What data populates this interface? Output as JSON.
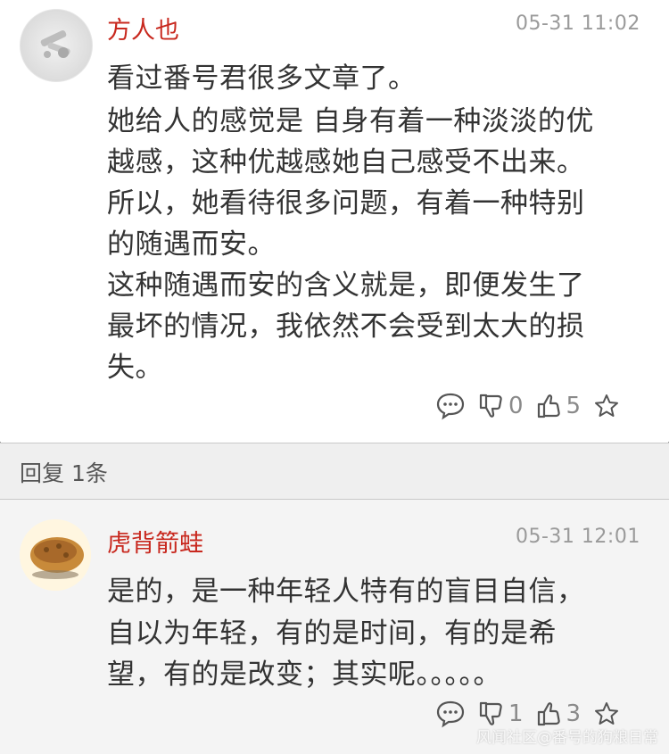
{
  "comments": [
    {
      "user": "方人也",
      "time": "05-31 11:02",
      "lines": [
        "看过番号君很多文章了。",
        "她给人的感觉是 自身有着一种淡淡的优",
        "越感，这种优越感她自己感受不出来。",
        "所以，她看待很多问题，有着一种特别",
        "的随遇而安。",
        "这种随遇而安的含义就是，即便发生了",
        "最坏的情况，我依然不会受到太大的损",
        "失。"
      ],
      "dislikes": "0",
      "likes": "5",
      "icons": [
        "comment-icon",
        "thumbs-down-icon",
        "thumbs-up-icon",
        "star-icon"
      ]
    }
  ],
  "reply_header": {
    "label": "回复 1条"
  },
  "replies": [
    {
      "user": "虎背箭蛙",
      "time": "05-31 12:01",
      "lines": [
        "是的，是一种年轻人特有的盲目自信，",
        "自以为年轻，有的是时间，有的是希",
        "望，有的是改变；其实呢。。。。。"
      ],
      "dislikes": "1",
      "likes": "3",
      "icons": [
        "comment-icon",
        "thumbs-down-icon",
        "thumbs-up-icon",
        "star-icon"
      ]
    }
  ],
  "watermark": "风闻社区@番号的狗粮日常",
  "colors": {
    "username": "#c8281e",
    "time": "#9a9a9a",
    "text": "#333333",
    "reply_bg": "#f4f4f4"
  }
}
